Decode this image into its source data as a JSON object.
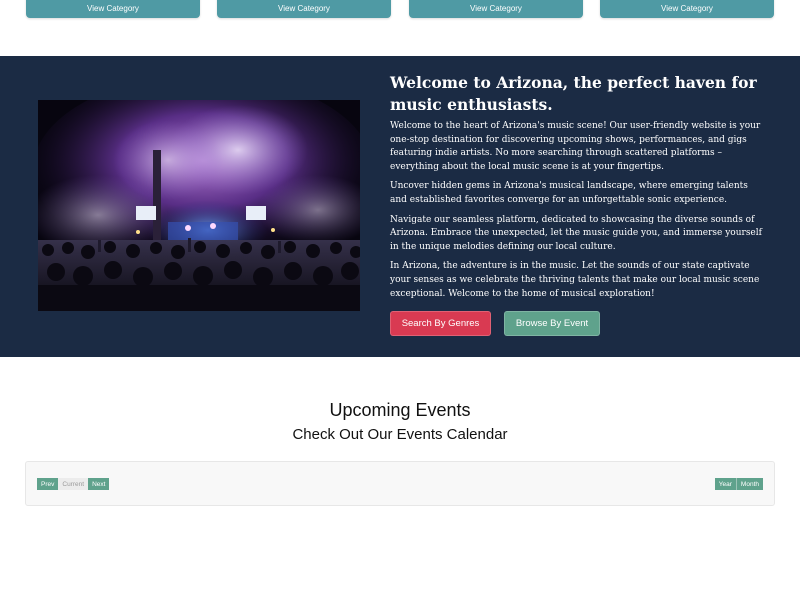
{
  "categories": {
    "buttons": [
      "View Category",
      "View Category",
      "View Category",
      "View Category"
    ]
  },
  "hero": {
    "title": "Welcome to Arizona, the perfect haven for music enthusiasts.",
    "paragraphs": [
      "Welcome to the heart of Arizona's music scene! Our user-friendly website is your one-stop destination for discovering upcoming shows, performances, and gigs featuring indie artists. No more searching through scattered platforms – everything about the local music scene is at your fingertips.",
      "Uncover hidden gems in Arizona's musical landscape, where emerging talents and established favorites converge for an unforgettable sonic experience.",
      "Navigate our seamless platform, dedicated to showcasing the diverse sounds of Arizona. Embrace the unexpected, let the music guide you, and immerse yourself in the unique melodies defining our local culture.",
      "In Arizona, the adventure is in the music. Let the sounds of our state captivate your senses as we celebrate the thriving talents that make our local music scene exceptional. Welcome to the home of musical exploration!"
    ],
    "search_genres_label": "Search By Genres",
    "browse_event_label": "Browse By Event",
    "colors": {
      "background": "#1b2b44",
      "genres_button": "#d93a52",
      "event_button": "#5fa28c"
    }
  },
  "events": {
    "title": "Upcoming Events",
    "subtitle": "Check Out Our Events Calendar",
    "pager": {
      "prev": "Prev",
      "current": "Current",
      "next": "Next"
    },
    "views": {
      "year": "Year",
      "month": "Month"
    }
  }
}
